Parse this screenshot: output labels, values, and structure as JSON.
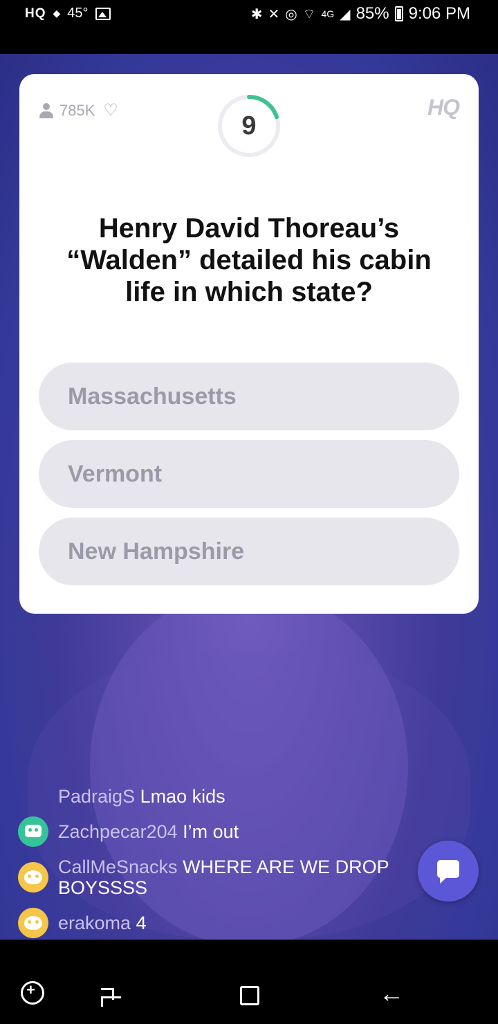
{
  "status_bar": {
    "left_app": "HQ",
    "temperature": "45°",
    "battery": "85%",
    "time": "9:06 PM",
    "network": "4G"
  },
  "card": {
    "viewers": "785K",
    "logo": "HQ",
    "timer": "9",
    "timer_progress": 0.2,
    "question": "Henry David Thoreau’s “Walden” detailed his cabin life in which state?",
    "answers": [
      "Massachusetts",
      "Vermont",
      "New Hampshire"
    ]
  },
  "chat": {
    "messages": [
      {
        "user": "PadraigS",
        "text": "Lmao kids",
        "avatar": "none"
      },
      {
        "user": "Zachpecar204",
        "text": "I’m out",
        "avatar": "robot-icon"
      },
      {
        "user": "CallMeSnacks",
        "text": "WHERE ARE WE DROP BOYSSSS",
        "avatar": "cat-icon"
      },
      {
        "user": "erakoma",
        "text": "4",
        "avatar": "cat-icon"
      }
    ]
  },
  "colors": {
    "accent": "#5c57d6",
    "timer_green": "#3ec28f",
    "background": "#3f3a98"
  }
}
